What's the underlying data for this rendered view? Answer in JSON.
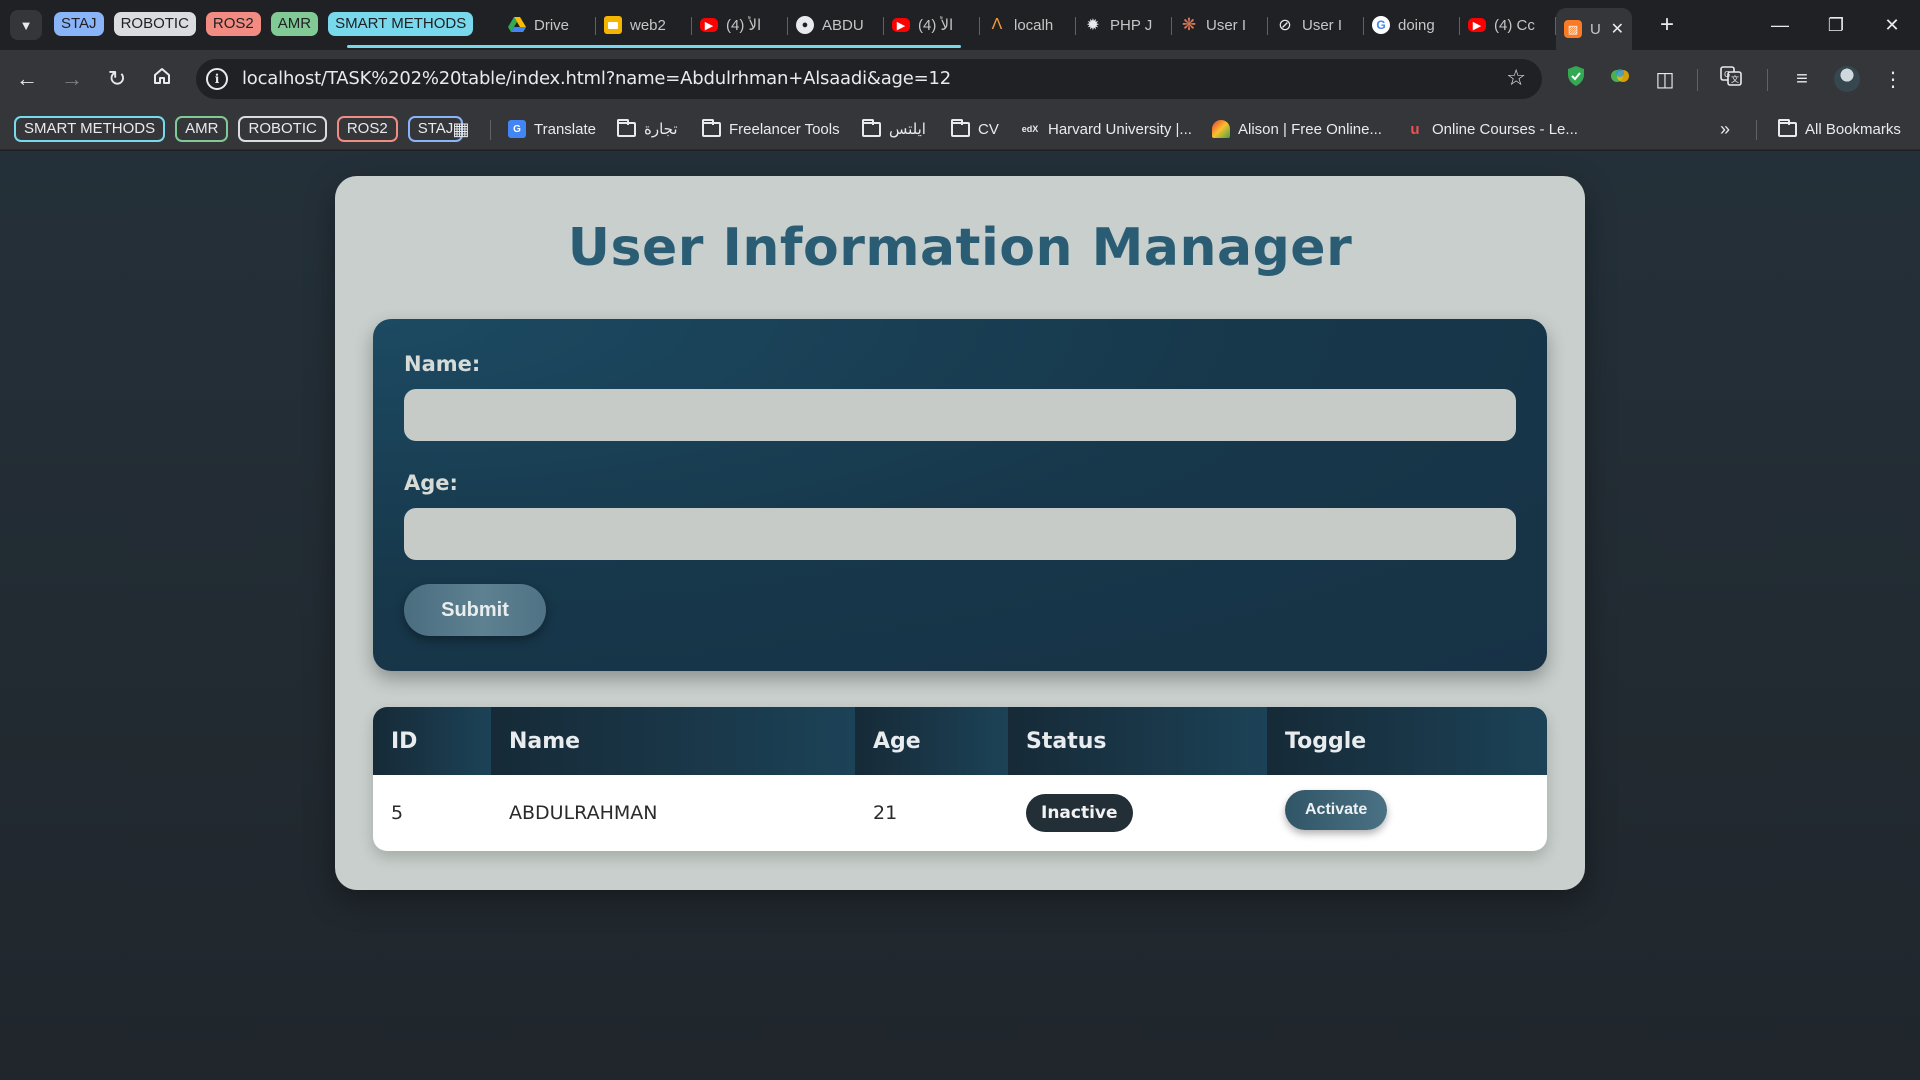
{
  "browser": {
    "tab_groups": [
      {
        "label": "STAJ",
        "color": "#8ab4f8"
      },
      {
        "label": "ROBOTIC",
        "color": "#dadce0"
      },
      {
        "label": "ROS2",
        "color": "#f28b82"
      },
      {
        "label": "AMR",
        "color": "#81c995"
      },
      {
        "label": "SMART METHODS",
        "color": "#78d9ec"
      }
    ],
    "tabs": [
      {
        "title": "Drive",
        "icon": "google-drive-icon"
      },
      {
        "title": "web2",
        "icon": "slides-icon"
      },
      {
        "title": "(4) الأ",
        "icon": "youtube-icon"
      },
      {
        "title": "ABDU",
        "icon": "github-icon"
      },
      {
        "title": "(4) الأ",
        "icon": "youtube-icon"
      },
      {
        "title": "localh",
        "icon": "xampp-icon"
      },
      {
        "title": "PHP J",
        "icon": "openai-icon"
      },
      {
        "title": "User I",
        "icon": "claude-icon"
      },
      {
        "title": "User I",
        "icon": "no-entry-icon"
      },
      {
        "title": "doing",
        "icon": "google-icon"
      },
      {
        "title": "(4) Cc",
        "icon": "youtube-icon"
      },
      {
        "title": "U",
        "icon": "xampp-icon",
        "active": true
      }
    ],
    "url": "localhost/TASK%202%20table/index.html?name=Abdulrhman+Alsaadi&age=12",
    "bookmark_groups": [
      {
        "label": "SMART METHODS",
        "color": "#78d9ec"
      },
      {
        "label": "AMR",
        "color": "#81c995"
      },
      {
        "label": "ROBOTIC",
        "color": "#dadce0"
      },
      {
        "label": "ROS2",
        "color": "#f28b82"
      },
      {
        "label": "STAJ",
        "color": "#8ab4f8"
      }
    ],
    "bookmarks": {
      "translate": "Translate",
      "tijara": "تجارة",
      "freelancer": "Freelancer Tools",
      "ielts": "ايلتس",
      "cv": "CV",
      "harvard": "Harvard University |...",
      "alison": "Alison | Free Online...",
      "online_courses": "Online Courses - Le...",
      "all_bookmarks": "All Bookmarks"
    }
  },
  "page": {
    "title": "User Information Manager",
    "form": {
      "name_label": "Name:",
      "name_value": "",
      "age_label": "Age:",
      "age_value": "",
      "submit_label": "Submit"
    },
    "table": {
      "headers": [
        "ID",
        "Name",
        "Age",
        "Status",
        "Toggle"
      ],
      "rows": [
        {
          "id": "5",
          "name": "ABDULRAHMAN",
          "age": "21",
          "status": "Inactive",
          "toggle": "Activate"
        }
      ]
    }
  }
}
